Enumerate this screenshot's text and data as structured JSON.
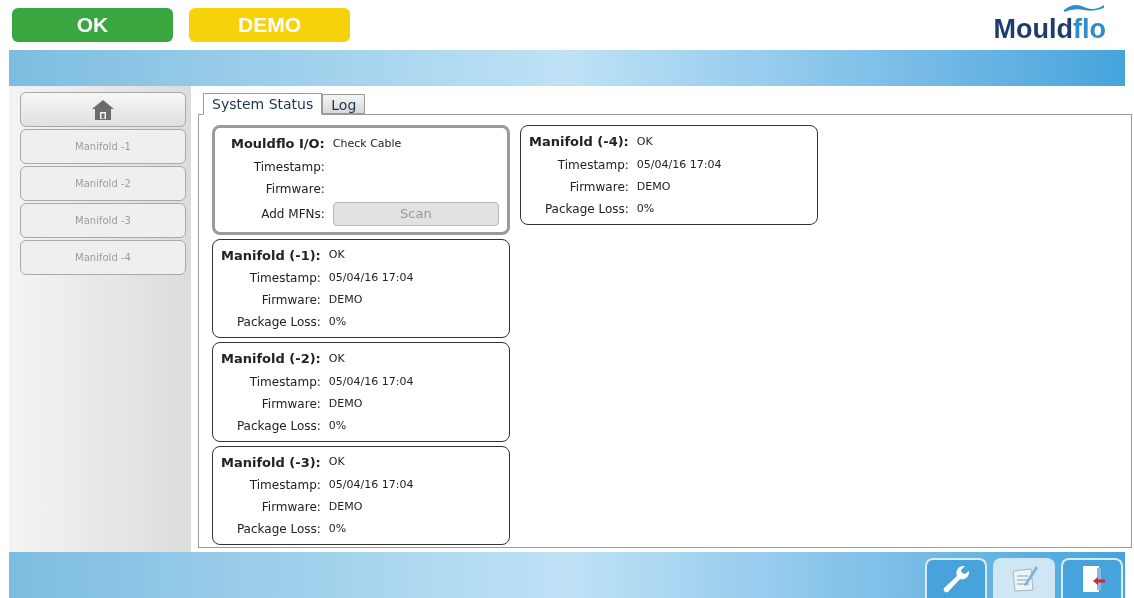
{
  "status_badges": [
    {
      "label": "OK",
      "color": "#3aa63f"
    },
    {
      "label": "DEMO",
      "color": "#f5d20a"
    }
  ],
  "logo": {
    "text_dark": "Mould",
    "text_accent": "flo"
  },
  "sidebar": {
    "items": [
      {
        "kind": "home",
        "disabled": false
      },
      {
        "kind": "text",
        "label": "Manifold -1",
        "disabled": true
      },
      {
        "kind": "text",
        "label": "Manifold -2",
        "disabled": true
      },
      {
        "kind": "text",
        "label": "Manifold -3",
        "disabled": true
      },
      {
        "kind": "text",
        "label": "Manifold -4",
        "disabled": true
      }
    ]
  },
  "tabs": [
    {
      "label": "System Status",
      "selected": true
    },
    {
      "label": "Log",
      "selected": false
    }
  ],
  "columns": [
    [
      {
        "kind": "io",
        "title": "Mouldflo I/O:",
        "status": "Check Cable",
        "rows": [
          {
            "label": "Timestamp:",
            "value": ""
          },
          {
            "label": "Firmware:",
            "value": ""
          }
        ],
        "action_label": "Add MFNs:",
        "action_button": {
          "label": "Scan",
          "disabled": true
        }
      },
      {
        "kind": "manifold",
        "title": "Manifold (-1):",
        "status": "OK",
        "rows": [
          {
            "label": "Timestamp:",
            "value": "05/04/16 17:04"
          },
          {
            "label": "Firmware:",
            "value": "DEMO"
          },
          {
            "label": "Package Loss:",
            "value": "0%"
          }
        ]
      },
      {
        "kind": "manifold",
        "title": "Manifold (-2):",
        "status": "OK",
        "rows": [
          {
            "label": "Timestamp:",
            "value": "05/04/16 17:04"
          },
          {
            "label": "Firmware:",
            "value": "DEMO"
          },
          {
            "label": "Package Loss:",
            "value": "0%"
          }
        ]
      },
      {
        "kind": "manifold",
        "title": "Manifold (-3):",
        "status": "OK",
        "rows": [
          {
            "label": "Timestamp:",
            "value": "05/04/16 17:04"
          },
          {
            "label": "Firmware:",
            "value": "DEMO"
          },
          {
            "label": "Package Loss:",
            "value": "0%"
          }
        ]
      }
    ],
    [
      {
        "kind": "manifold",
        "title": "Manifold (-4):",
        "status": "OK",
        "rows": [
          {
            "label": "Timestamp:",
            "value": "05/04/16 17:04"
          },
          {
            "label": "Firmware:",
            "value": "DEMO"
          },
          {
            "label": "Package Loss:",
            "value": "0%"
          }
        ]
      }
    ]
  ],
  "toolbar": [
    {
      "kind": "wrench",
      "selected": false
    },
    {
      "kind": "notes",
      "selected": true
    },
    {
      "kind": "exit",
      "selected": false
    }
  ]
}
